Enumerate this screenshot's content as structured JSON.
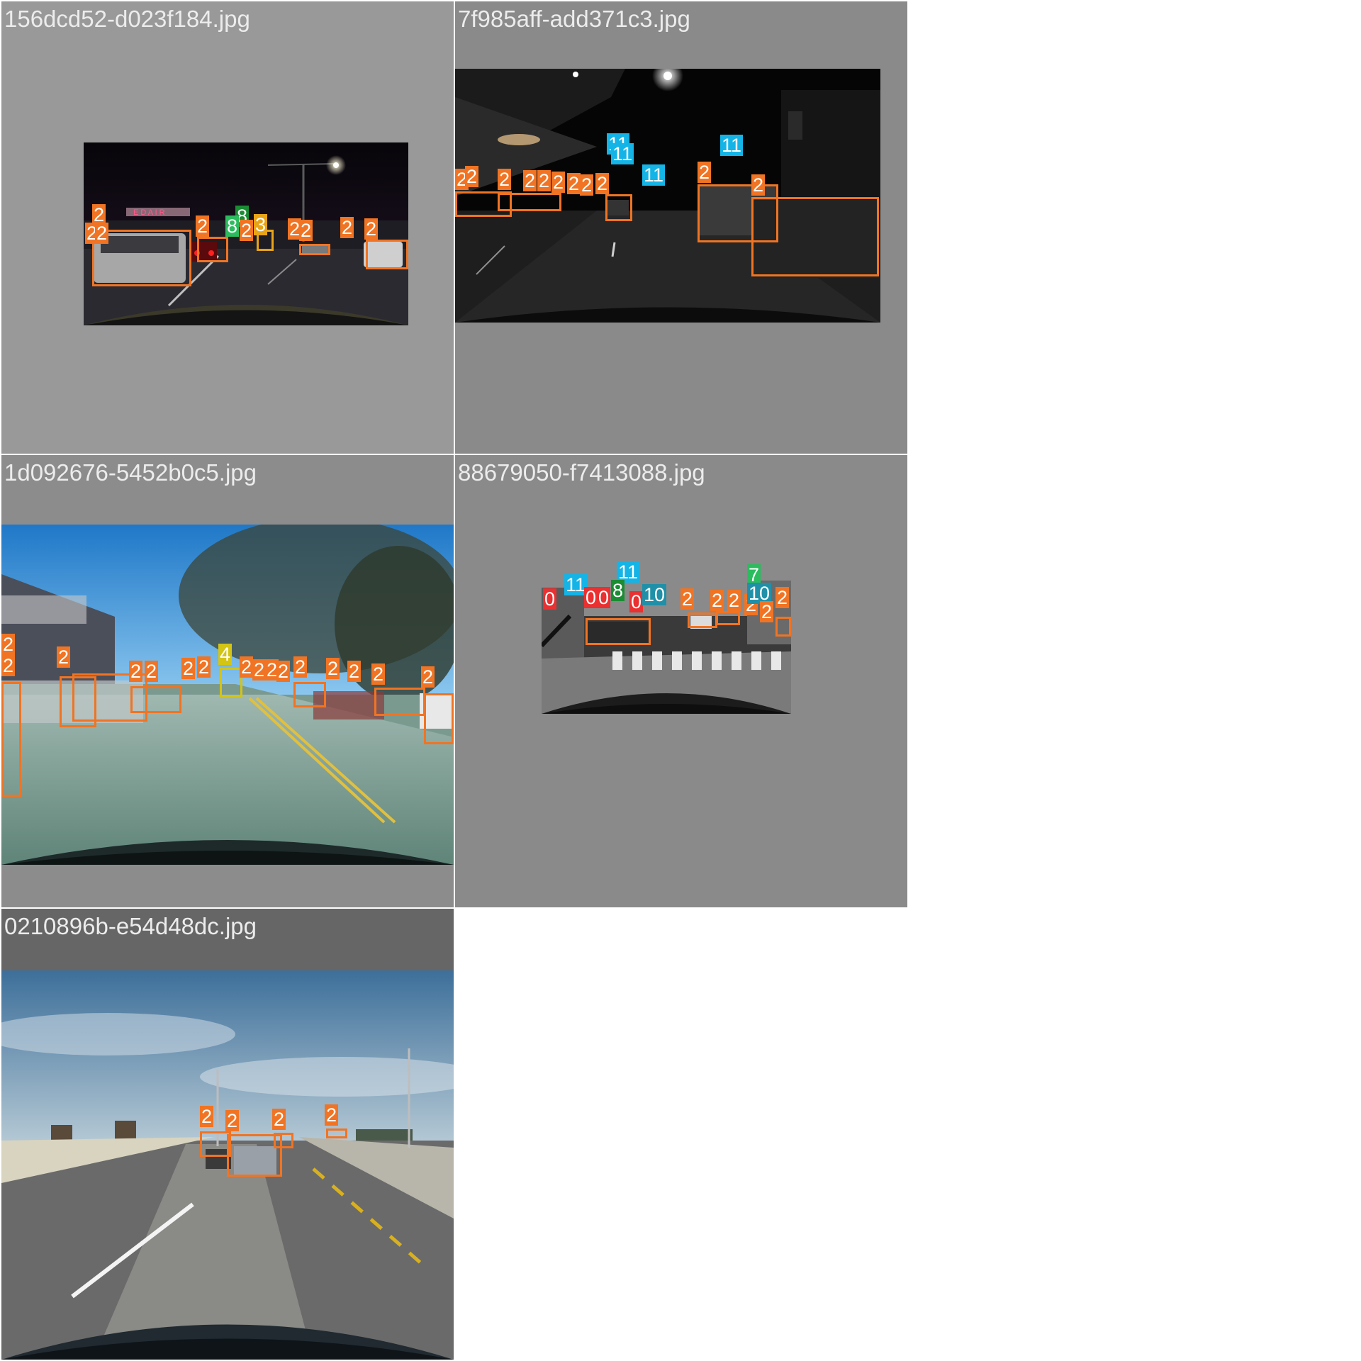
{
  "colors": {
    "car": "#f07423",
    "traffic_light": "#14b4e6",
    "traffic_sign": "#2bbc5e",
    "bus": "#d4c414",
    "truck": "#e8a418",
    "rider": "#1a8c33",
    "person": "#ea3030",
    "misc": "#2090a8"
  },
  "tiles": [
    {
      "filename": "156dcd52-d023f184.jpg",
      "detections": [
        {
          "label": "2",
          "cls": "car"
        },
        {
          "label": "2",
          "cls": "car"
        },
        {
          "label": "2",
          "cls": "car"
        },
        {
          "label": "2",
          "cls": "car"
        },
        {
          "label": "8",
          "cls": "rider"
        },
        {
          "label": "8",
          "cls": "rider"
        },
        {
          "label": "2",
          "cls": "car"
        },
        {
          "label": "3",
          "cls": "truck"
        },
        {
          "label": "2",
          "cls": "car"
        },
        {
          "label": "2",
          "cls": "car"
        },
        {
          "label": "2",
          "cls": "car"
        },
        {
          "label": "2",
          "cls": "car"
        }
      ]
    },
    {
      "filename": "7f985aff-add371c3.jpg",
      "detections": [
        {
          "label": "2",
          "cls": "car"
        },
        {
          "label": "2",
          "cls": "car"
        },
        {
          "label": "2",
          "cls": "car"
        },
        {
          "label": "2",
          "cls": "car"
        },
        {
          "label": "2",
          "cls": "car"
        },
        {
          "label": "2",
          "cls": "car"
        },
        {
          "label": "2",
          "cls": "car"
        },
        {
          "label": "2",
          "cls": "car"
        },
        {
          "label": "2",
          "cls": "car"
        },
        {
          "label": "11",
          "cls": "traffic_light"
        },
        {
          "label": "11",
          "cls": "traffic_light"
        },
        {
          "label": "11",
          "cls": "traffic_light"
        },
        {
          "label": "11",
          "cls": "traffic_light"
        },
        {
          "label": "2",
          "cls": "car"
        },
        {
          "label": "2",
          "cls": "car"
        }
      ]
    },
    {
      "filename": "1d092676-5452b0c5.jpg",
      "detections": [
        {
          "label": "2",
          "cls": "car"
        },
        {
          "label": "2",
          "cls": "car"
        },
        {
          "label": "2",
          "cls": "car"
        },
        {
          "label": "2",
          "cls": "car"
        },
        {
          "label": "2",
          "cls": "car"
        },
        {
          "label": "2",
          "cls": "car"
        },
        {
          "label": "2",
          "cls": "car"
        },
        {
          "label": "4",
          "cls": "bus"
        },
        {
          "label": "2",
          "cls": "car"
        },
        {
          "label": "2",
          "cls": "car"
        },
        {
          "label": "2",
          "cls": "car"
        },
        {
          "label": "2",
          "cls": "car"
        },
        {
          "label": "2",
          "cls": "car"
        },
        {
          "label": "2",
          "cls": "car"
        },
        {
          "label": "2",
          "cls": "car"
        },
        {
          "label": "2",
          "cls": "car"
        },
        {
          "label": "2",
          "cls": "car"
        }
      ]
    },
    {
      "filename": "88679050-f7413088.jpg",
      "detections": [
        {
          "label": "11",
          "cls": "traffic_light"
        },
        {
          "label": "11",
          "cls": "traffic_light"
        },
        {
          "label": "0",
          "cls": "person"
        },
        {
          "label": "0",
          "cls": "person"
        },
        {
          "label": "0",
          "cls": "person"
        },
        {
          "label": "8",
          "cls": "rider"
        },
        {
          "label": "0",
          "cls": "person"
        },
        {
          "label": "10",
          "cls": "misc"
        },
        {
          "label": "2",
          "cls": "car"
        },
        {
          "label": "2",
          "cls": "car"
        },
        {
          "label": "2",
          "cls": "car"
        },
        {
          "label": "2",
          "cls": "car"
        },
        {
          "label": "7",
          "cls": "traffic_sign"
        },
        {
          "label": "10",
          "cls": "misc"
        },
        {
          "label": "2",
          "cls": "car"
        },
        {
          "label": "2",
          "cls": "car"
        }
      ]
    },
    {
      "filename": "0210896b-e54d48dc.jpg",
      "detections": [
        {
          "label": "2",
          "cls": "car"
        },
        {
          "label": "2",
          "cls": "car"
        },
        {
          "label": "2",
          "cls": "car"
        },
        {
          "label": "2",
          "cls": "car"
        }
      ]
    }
  ]
}
